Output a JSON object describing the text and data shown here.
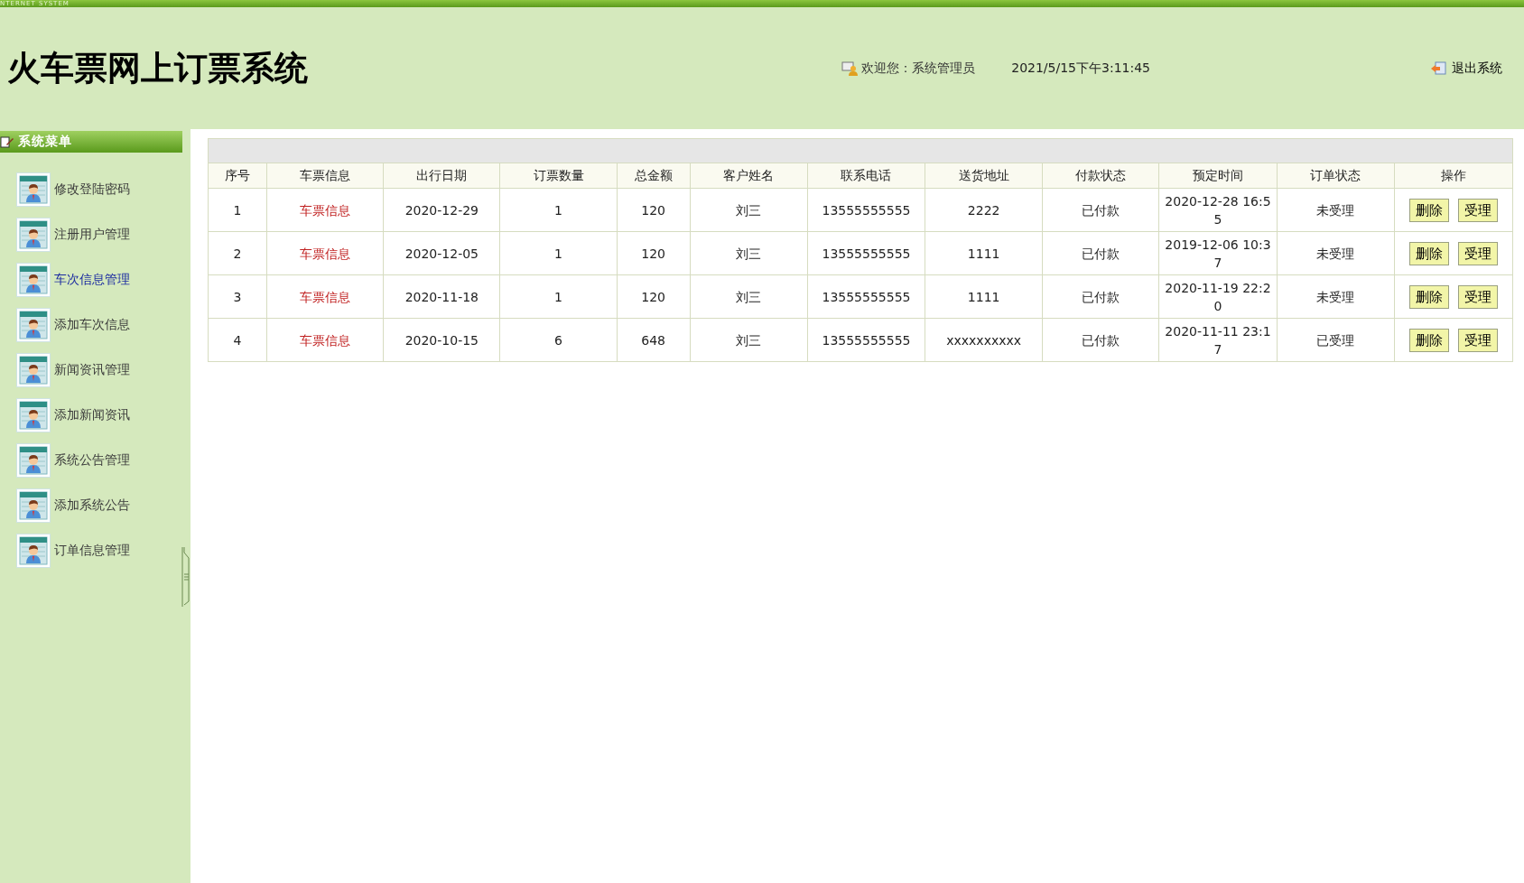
{
  "banner": {
    "tagline": "NTERNET SYSTEM",
    "title": "火车票网上订票系统",
    "welcome": "欢迎您：系统管理员",
    "datetime": "2021/5/15下午3:11:45",
    "logout": "退出系统"
  },
  "sidebar": {
    "title": "系统菜单",
    "items": [
      {
        "label": "修改登陆密码",
        "selected": false
      },
      {
        "label": "注册用户管理",
        "selected": false
      },
      {
        "label": "车次信息管理",
        "selected": true
      },
      {
        "label": "添加车次信息",
        "selected": false
      },
      {
        "label": "新闻资讯管理",
        "selected": false
      },
      {
        "label": "添加新闻资讯",
        "selected": false
      },
      {
        "label": "系统公告管理",
        "selected": false
      },
      {
        "label": "添加系统公告",
        "selected": false
      },
      {
        "label": "订单信息管理",
        "selected": false
      }
    ]
  },
  "table": {
    "columns": [
      "序号",
      "车票信息",
      "出行日期",
      "订票数量",
      "总金额",
      "客户姓名",
      "联系电话",
      "送货地址",
      "付款状态",
      "预定时间",
      "订单状态",
      "操作"
    ],
    "rows": [
      {
        "cells": [
          "1",
          "车票信息",
          "2020-12-29",
          "1",
          "120",
          "刘三",
          "13555555555",
          "2222",
          "已付款",
          "2020-12-28 16:55",
          "未受理"
        ],
        "actions": [
          "删除",
          "受理"
        ]
      },
      {
        "cells": [
          "2",
          "车票信息",
          "2020-12-05",
          "1",
          "120",
          "刘三",
          "13555555555",
          "1111",
          "已付款",
          "2019-12-06 10:37",
          "未受理"
        ],
        "actions": [
          "删除",
          "受理"
        ]
      },
      {
        "cells": [
          "3",
          "车票信息",
          "2020-11-18",
          "1",
          "120",
          "刘三",
          "13555555555",
          "1111",
          "已付款",
          "2020-11-19 22:20",
          "未受理"
        ],
        "actions": [
          "删除",
          "受理"
        ]
      },
      {
        "cells": [
          "4",
          "车票信息",
          "2020-10-15",
          "6",
          "648",
          "刘三",
          "13555555555",
          "xxxxxxxxxx",
          "已付款",
          "2020-11-11 23:17",
          "已受理"
        ],
        "actions": [
          "删除",
          "受理"
        ]
      }
    ]
  }
}
